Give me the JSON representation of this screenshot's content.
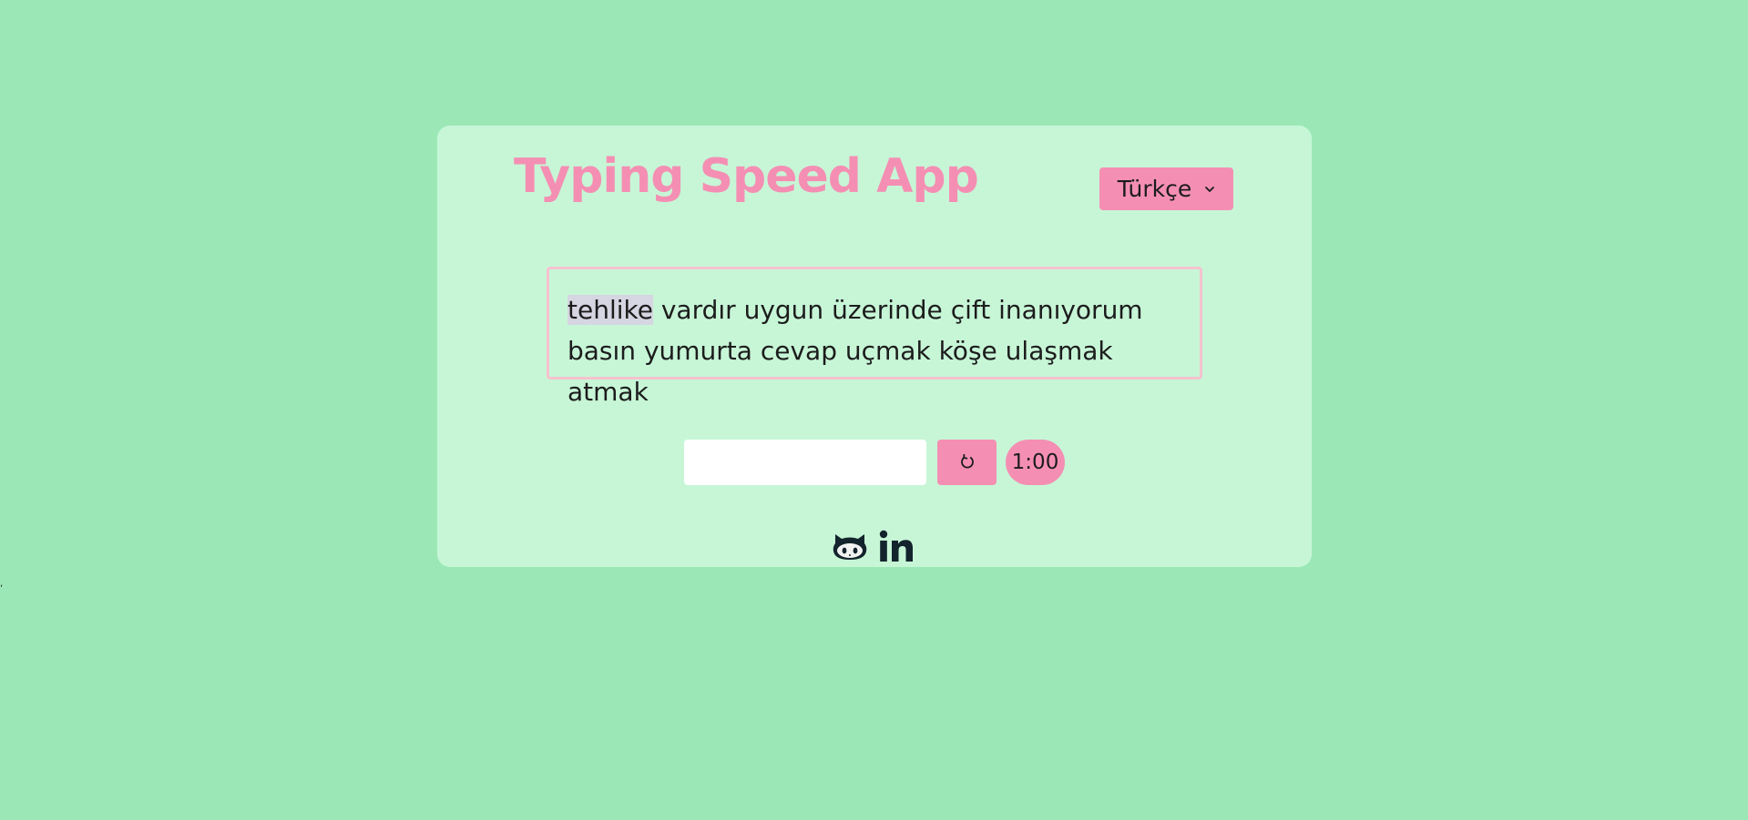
{
  "app": {
    "title": "Typing Speed App",
    "stray_mark": ","
  },
  "language_selector": {
    "selected": "Türkçe",
    "icon": "chevron-down-icon"
  },
  "words": {
    "items": [
      "tehlike",
      "vardır",
      "uygun",
      "üzerinde",
      "çift",
      "inanıyorum",
      "basın",
      "yumurta",
      "cevap",
      "uçmak",
      "köşe",
      "ulaşmak",
      "atmak"
    ],
    "current_index": 0
  },
  "input": {
    "value": "",
    "placeholder": ""
  },
  "controls": {
    "reset_icon": "reset-icon",
    "timer": "1:00"
  },
  "social": {
    "github_icon": "github-icon",
    "linkedin_icon": "linkedin-icon"
  },
  "colors": {
    "background": "#9be8b6",
    "card": "#c7f6d7",
    "accent": "#f48fb3",
    "highlight": "#d6d5e2",
    "text_box_border": "#f5c2cd",
    "icon": "#13242c"
  }
}
